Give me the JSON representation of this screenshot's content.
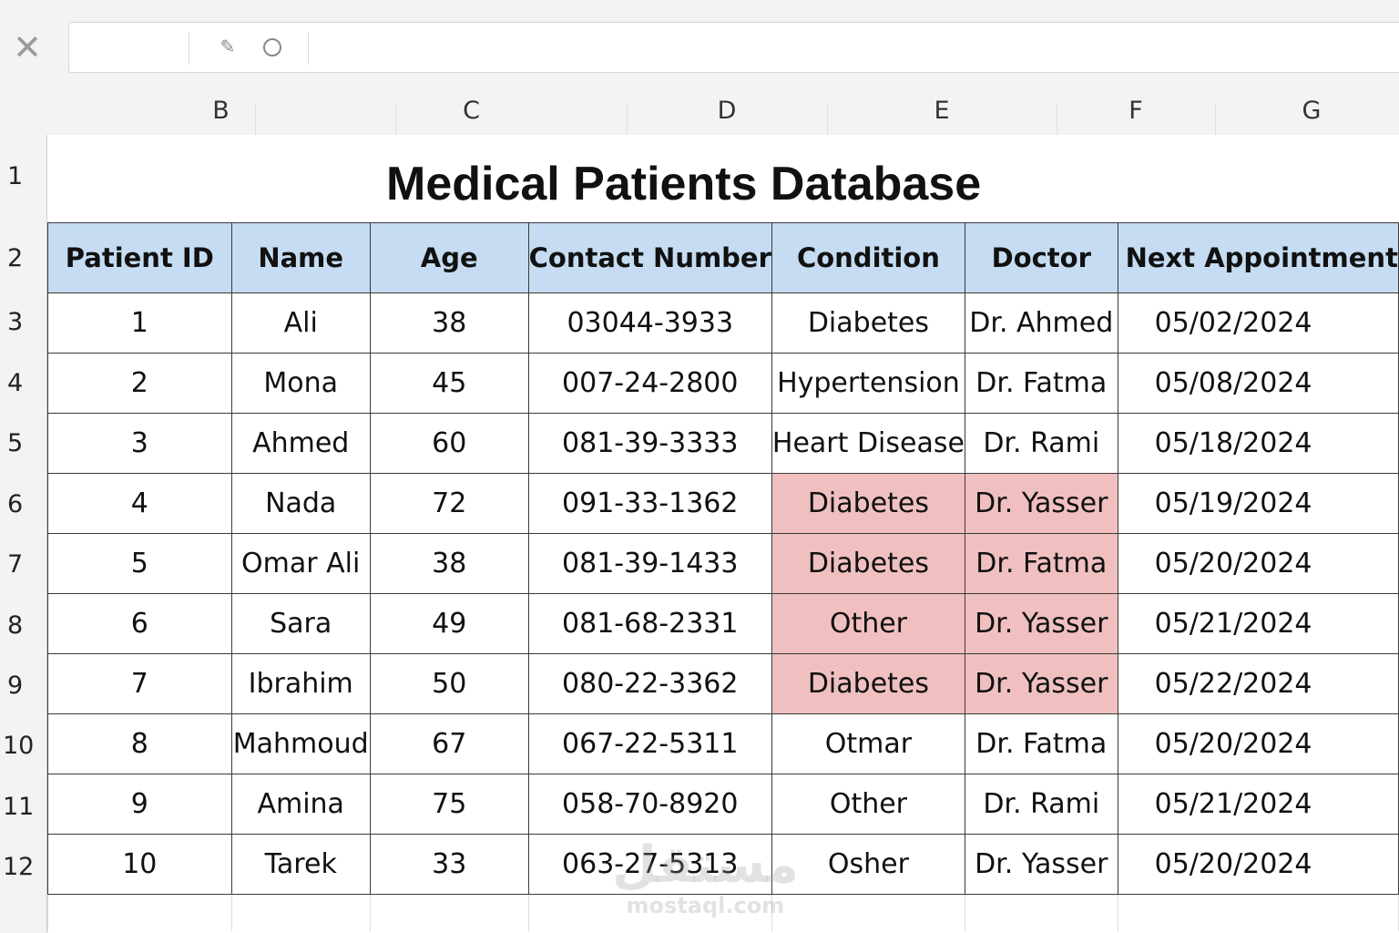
{
  "formula_bar": {
    "name_box_value": "",
    "formula_value": "",
    "icons": [
      "close-icon",
      "pencil-icon",
      "circle-icon"
    ]
  },
  "columns": [
    "B",
    "C",
    "D",
    "E",
    "F",
    "G"
  ],
  "rows": [
    "1",
    "2",
    "3",
    "4",
    "5",
    "6",
    "7",
    "8",
    "9",
    "10",
    "11",
    "12"
  ],
  "sheet": {
    "title": "Medical Patients Database",
    "headers": [
      "Patient ID",
      "Name",
      "Age",
      "Contact Number",
      "Condition",
      "Doctor",
      "Next Appointment"
    ],
    "records": [
      {
        "id": "1",
        "name": "Ali",
        "age": "38",
        "contact": "03044-3933",
        "condition": "Diabetes",
        "doctor": "Dr. Ahmed",
        "next": "05/02/2024",
        "highlight": false
      },
      {
        "id": "2",
        "name": "Mona",
        "age": "45",
        "contact": "007-24-2800",
        "condition": "Hypertension",
        "doctor": "Dr. Fatma",
        "next": "05/08/2024",
        "highlight": false
      },
      {
        "id": "3",
        "name": "Ahmed",
        "age": "60",
        "contact": "081-39-3333",
        "condition": "Heart Disease",
        "doctor": "Dr. Rami",
        "next": "05/18/2024",
        "highlight": false
      },
      {
        "id": "4",
        "name": "Nada",
        "age": "72",
        "contact": "091-33-1362",
        "condition": "Diabetes",
        "doctor": "Dr. Yasser",
        "next": "05/19/2024",
        "highlight": true
      },
      {
        "id": "5",
        "name": "Omar Ali",
        "age": "38",
        "contact": "081-39-1433",
        "condition": "Diabetes",
        "doctor": "Dr. Fatma",
        "next": "05/20/2024",
        "highlight": true
      },
      {
        "id": "6",
        "name": "Sara",
        "age": "49",
        "contact": "081-68-2331",
        "condition": "Other",
        "doctor": "Dr. Yasser",
        "next": "05/21/2024",
        "highlight": true
      },
      {
        "id": "7",
        "name": "Ibrahim",
        "age": "50",
        "contact": "080-22-3362",
        "condition": "Diabetes",
        "doctor": "Dr. Yasser",
        "next": "05/22/2024",
        "highlight": true
      },
      {
        "id": "8",
        "name": "Mahmoud",
        "age": "67",
        "contact": "067-22-5311",
        "condition": "Otmar",
        "doctor": "Dr. Fatma",
        "next": "05/20/2024",
        "highlight": false
      },
      {
        "id": "9",
        "name": "Amina",
        "age": "75",
        "contact": "058-70-8920",
        "condition": "Other",
        "doctor": "Dr. Rami",
        "next": "05/21/2024",
        "highlight": false
      },
      {
        "id": "10",
        "name": "Tarek",
        "age": "33",
        "contact": "063-27-5313",
        "condition": "Osher",
        "doctor": "Dr. Yasser",
        "next": "05/20/2024",
        "highlight": false
      }
    ]
  },
  "colors": {
    "header_fill": "#c5dcf2",
    "highlight_fill": "#f0c0c0",
    "chrome_bg": "#f3f3f3"
  },
  "watermark": {
    "arabic": "مستقل",
    "latin": "mostaql.com"
  }
}
